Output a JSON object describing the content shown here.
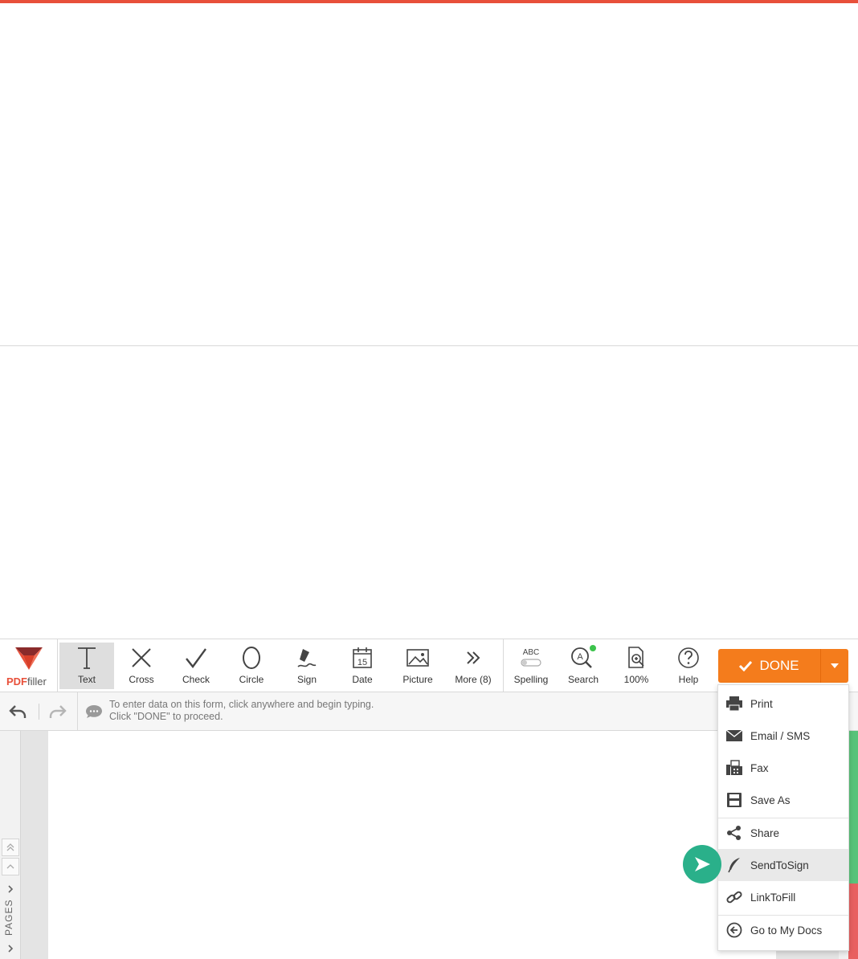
{
  "logo": {
    "brand": "PDF",
    "suffix": "filler"
  },
  "tools": [
    {
      "id": "text",
      "label": "Text",
      "icon": "text-t-icon"
    },
    {
      "id": "cross",
      "label": "Cross",
      "icon": "cross-icon"
    },
    {
      "id": "check",
      "label": "Check",
      "icon": "check-icon"
    },
    {
      "id": "circle",
      "label": "Circle",
      "icon": "circle-icon"
    },
    {
      "id": "sign",
      "label": "Sign",
      "icon": "sign-pen-icon"
    },
    {
      "id": "date",
      "label": "Date",
      "icon": "calendar-icon",
      "day": "15"
    },
    {
      "id": "picture",
      "label": "Picture",
      "icon": "picture-icon"
    },
    {
      "id": "more",
      "label": "More (8)",
      "icon": "double-chevron-icon"
    },
    {
      "id": "spelling",
      "label": "Spelling",
      "icon": "abc-toggle-icon",
      "abc": "ABC"
    },
    {
      "id": "search",
      "label": "Search",
      "icon": "search-icon"
    },
    {
      "id": "zoom",
      "label": "100%",
      "icon": "zoom-doc-icon"
    },
    {
      "id": "help",
      "label": "Help",
      "icon": "help-icon"
    }
  ],
  "done": {
    "label": "DONE"
  },
  "hint": {
    "line1": "To enter data on this form, click anywhere and begin typing.",
    "line2": "Click \"DONE\" to proceed."
  },
  "rail": {
    "pages_label": "PAGES"
  },
  "menu": {
    "items": [
      {
        "label": "Print",
        "icon": "printer-icon"
      },
      {
        "label": "Email / SMS",
        "icon": "envelope-icon"
      },
      {
        "label": "Fax",
        "icon": "fax-icon"
      },
      {
        "label": "Save As",
        "icon": "floppy-icon"
      },
      {
        "label": "Share",
        "icon": "share-icon"
      },
      {
        "label": "SendToSign",
        "icon": "quill-icon"
      },
      {
        "label": "LinkToFill",
        "icon": "link-icon"
      },
      {
        "label": "Go to My Docs",
        "icon": "back-circle-icon"
      }
    ]
  },
  "colors": {
    "accent": "#f47c1c",
    "brand": "#e8503a",
    "pointer": "#2ab08a",
    "status_green": "#59c37a",
    "status_red": "#e86060"
  }
}
